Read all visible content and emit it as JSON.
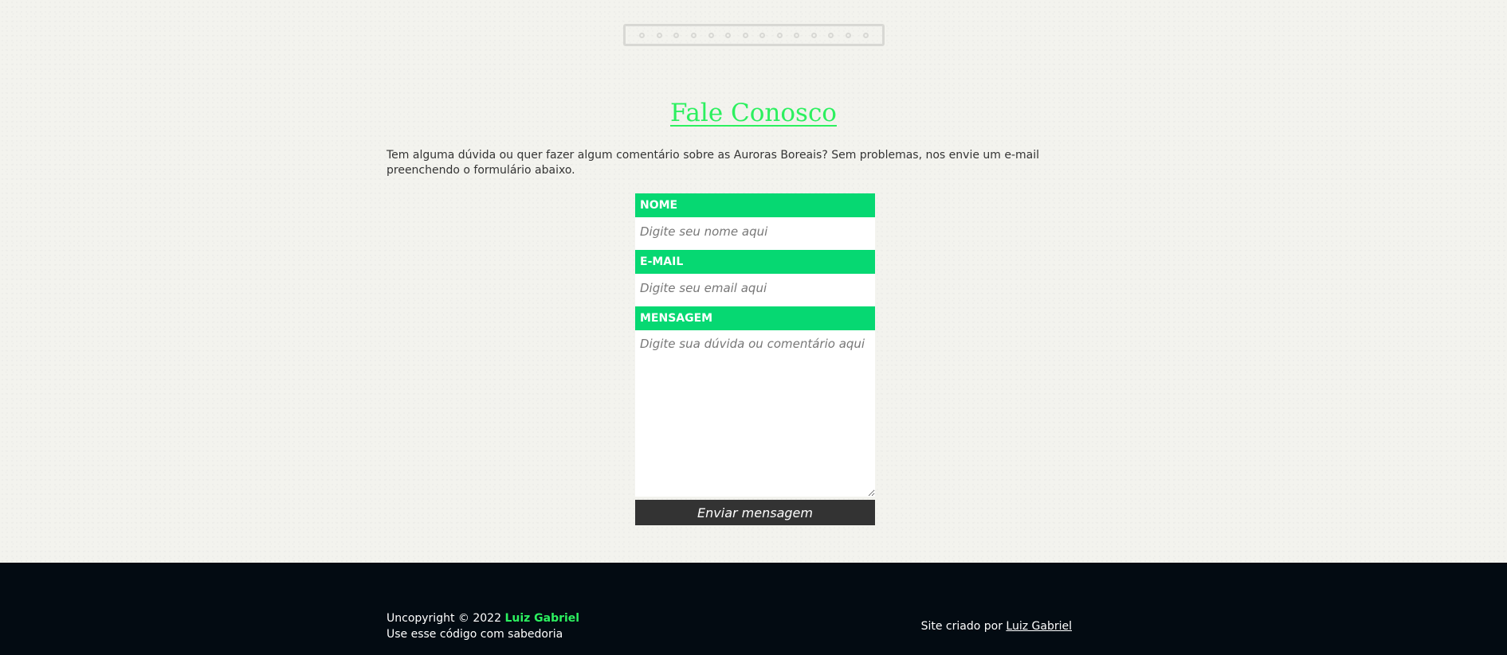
{
  "header": {
    "title": "Fale Conosco",
    "intro": "Tem alguma dúvida ou quer fazer algum comentário sobre as Auroras Boreais? Sem problemas, nos envie um e-mail preenchendo o formulário abaixo."
  },
  "form": {
    "name_label": "NOME",
    "name_placeholder": "Digite seu nome aqui",
    "email_label": "E-MAIL",
    "email_placeholder": "Digite seu email aqui",
    "message_label": "MENSAGEM",
    "message_placeholder": "Digite sua dúvida ou comentário aqui",
    "submit_label": "Enviar mensagem"
  },
  "footer": {
    "copyright_prefix": "Uncopyright © 2022",
    "copyright_name": "Luiz Gabriel",
    "tagline": "Use esse código com sabedoria",
    "credit_prefix": "Site criado por",
    "credit_link": "Luiz Gabriel"
  },
  "colors": {
    "accent": "#06d872",
    "title": "#2cf05f",
    "button_bg": "#333333",
    "footer_bg": "#030b12"
  }
}
